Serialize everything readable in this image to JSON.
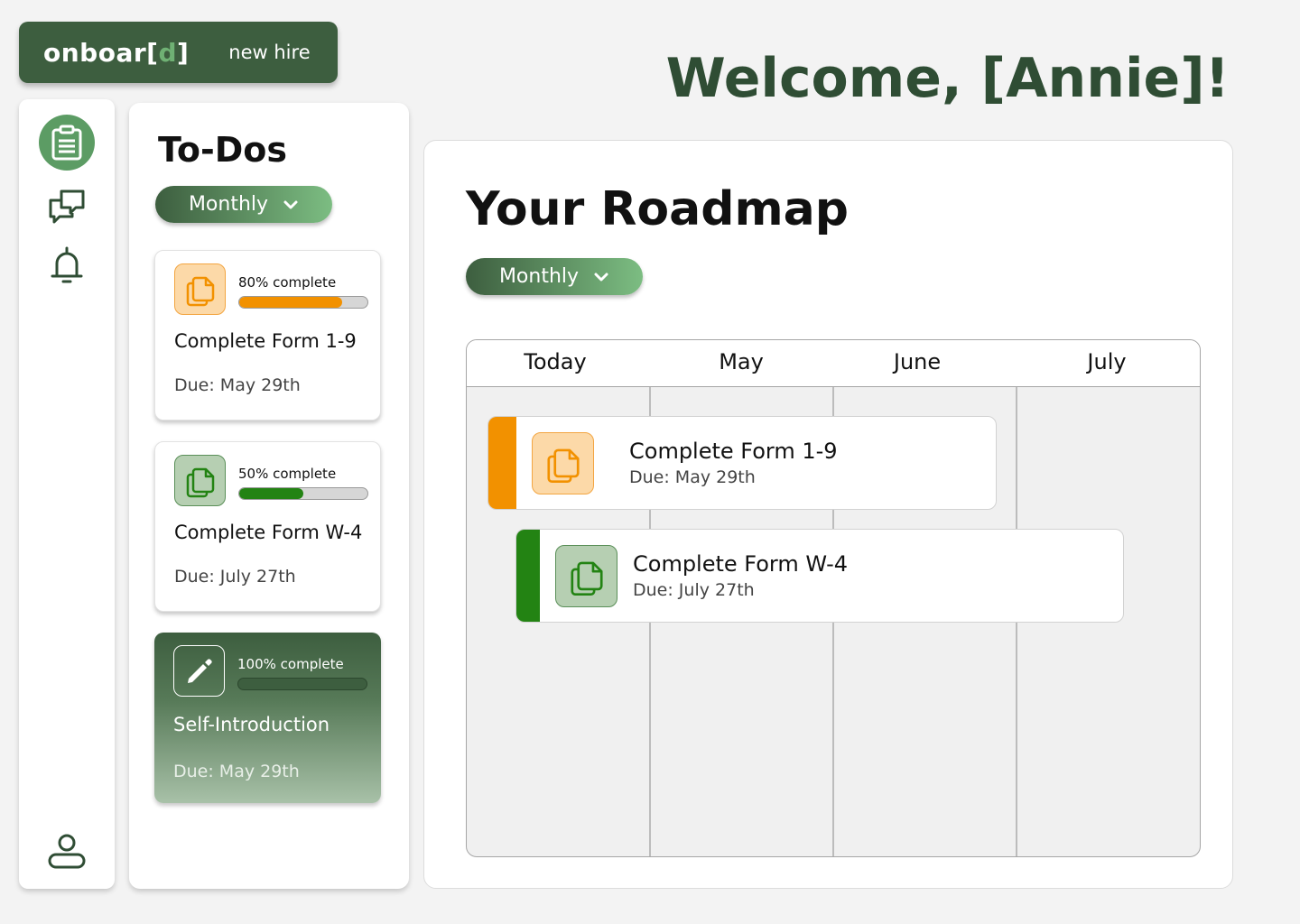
{
  "brand": {
    "logo_main": "onboar[",
    "logo_accent": "d",
    "logo_end": "]",
    "role": "new hire"
  },
  "welcome": "Welcome, [Annie]!",
  "nav": {
    "items": [
      {
        "name": "todos",
        "icon": "clipboard-icon",
        "active": true
      },
      {
        "name": "messages",
        "icon": "chat-bubbles-icon",
        "active": false
      },
      {
        "name": "notifications",
        "icon": "bell-icon",
        "active": false
      },
      {
        "name": "profile",
        "icon": "user-icon",
        "active": false
      }
    ]
  },
  "todos": {
    "title": "To-Dos",
    "filter": "Monthly",
    "items": [
      {
        "percent_label": "80% complete",
        "progress": 0.8,
        "title": "Complete Form 1-9",
        "due": "Due: May 29th",
        "icon": "document-copy-icon",
        "color": "#f29100"
      },
      {
        "percent_label": "50% complete",
        "progress": 0.5,
        "title": "Complete Form W-4",
        "due": "Due: July 27th",
        "icon": "document-copy-icon",
        "color": "#238313"
      },
      {
        "percent_label": "100% complete",
        "progress": 1.0,
        "title": "Self-Introduction",
        "due": "Due: May 29th",
        "icon": "pencil-icon",
        "color": "#3d5e3f"
      }
    ]
  },
  "roadmap": {
    "title": "Your Roadmap",
    "filter": "Monthly",
    "columns": [
      "Today",
      "May",
      "June",
      "July"
    ],
    "tasks": [
      {
        "title": "Complete Form 1-9",
        "due": "Due: May 29th",
        "color": "#f29100"
      },
      {
        "title": "Complete Form W-4",
        "due": "Due: July 27th",
        "color": "#238313"
      }
    ]
  }
}
